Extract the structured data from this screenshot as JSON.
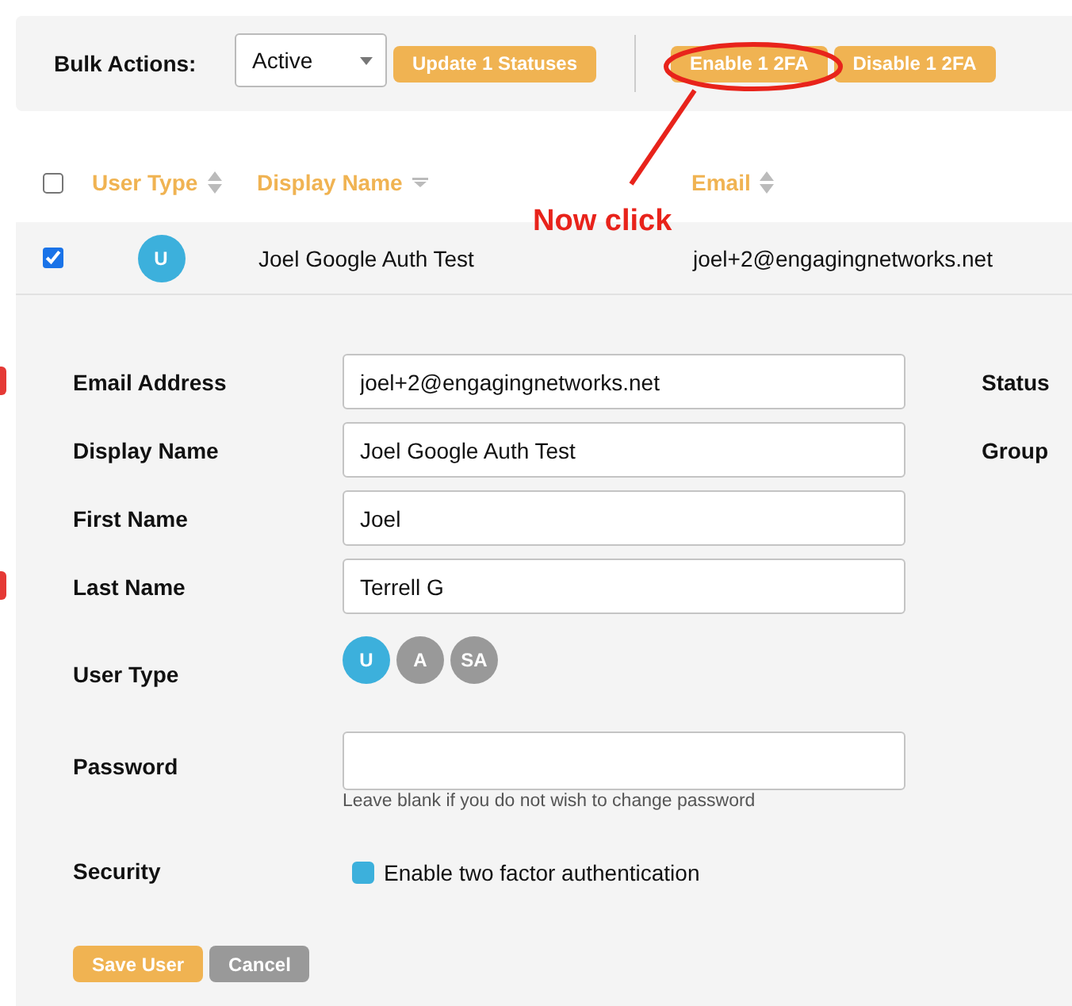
{
  "bulk_actions": {
    "label": "Bulk Actions:",
    "status_select": {
      "value": "Active"
    },
    "buttons": [
      {
        "label": "Update 1 Statuses"
      },
      {
        "label": "Enable 1 2FA"
      },
      {
        "label": "Disable 1 2FA"
      }
    ]
  },
  "annotation": {
    "text": "Now click"
  },
  "table": {
    "select_all": {
      "checked": false
    },
    "columns": [
      {
        "label": "User Type",
        "sorted": false
      },
      {
        "label": "Display Name",
        "sorted": true
      },
      {
        "label": "Email",
        "sorted": false
      }
    ],
    "rows": [
      {
        "checked": true,
        "user_type": "U",
        "display_name": "Joel Google Auth Test",
        "email": "joel+2@engagingnetworks.net"
      }
    ]
  },
  "edit_form": {
    "fields": [
      {
        "label": "Email Address",
        "value": "joel+2@engagingnetworks.net",
        "flagged": true
      },
      {
        "label": "Display Name",
        "value": "Joel Google Auth Test",
        "flagged": false
      },
      {
        "label": "First Name",
        "value": "Joel",
        "flagged": false
      },
      {
        "label": "Last Name",
        "value": "Terrell G",
        "flagged": true
      }
    ],
    "side_labels": [
      "Status",
      "Group"
    ],
    "user_type": {
      "label": "User Type",
      "options": [
        {
          "label": "U",
          "selected": true
        },
        {
          "label": "A",
          "selected": false
        },
        {
          "label": "SA",
          "selected": false
        }
      ]
    },
    "password": {
      "label": "Password",
      "hint": "Leave blank if you do not wish to change password"
    },
    "security": {
      "label": "Security",
      "option": "Enable two factor authentication",
      "checked": true
    },
    "buttons": [
      {
        "label": "Save User",
        "kind": "primary"
      },
      {
        "label": "Cancel",
        "kind": "secondary"
      }
    ]
  }
}
